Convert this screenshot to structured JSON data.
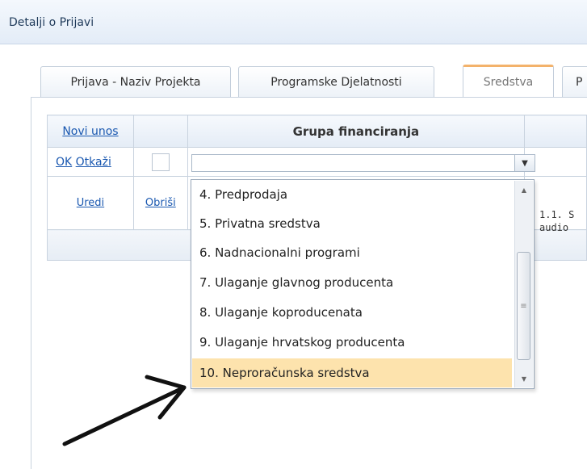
{
  "header": {
    "title": "Detalji o Prijavi"
  },
  "tabs": [
    {
      "label": "Prijava - Naziv Projekta",
      "active": false
    },
    {
      "label": "Programske Djelatnosti",
      "active": false
    },
    {
      "label": "Sredstva",
      "active": true
    },
    {
      "label": "P",
      "active": false
    }
  ],
  "grid": {
    "new_entry": "Novi unos",
    "column_header": "Grupa financiranja",
    "ok": "OK",
    "cancel": "Otkaži",
    "edit": "Uredi",
    "delete": "Obriši",
    "clipped_text_line1": "1.1. S",
    "clipped_text_line2": "audio"
  },
  "combo": {
    "value": ""
  },
  "dropdown": {
    "options": [
      "4. Predprodaja",
      "5. Privatna sredstva",
      "6. Nadnacionalni programi",
      "7. Ulaganje glavnog producenta",
      "8. Ulaganje koproducenata",
      "9. Ulaganje hrvatskog producenta",
      "10. Neproračunska sredstva"
    ],
    "selected": "10. Neproračunska sredstva"
  },
  "colors": {
    "highlight": "#fde3ad",
    "active_tab_border": "#f3b26b",
    "link": "#1a58b0"
  }
}
